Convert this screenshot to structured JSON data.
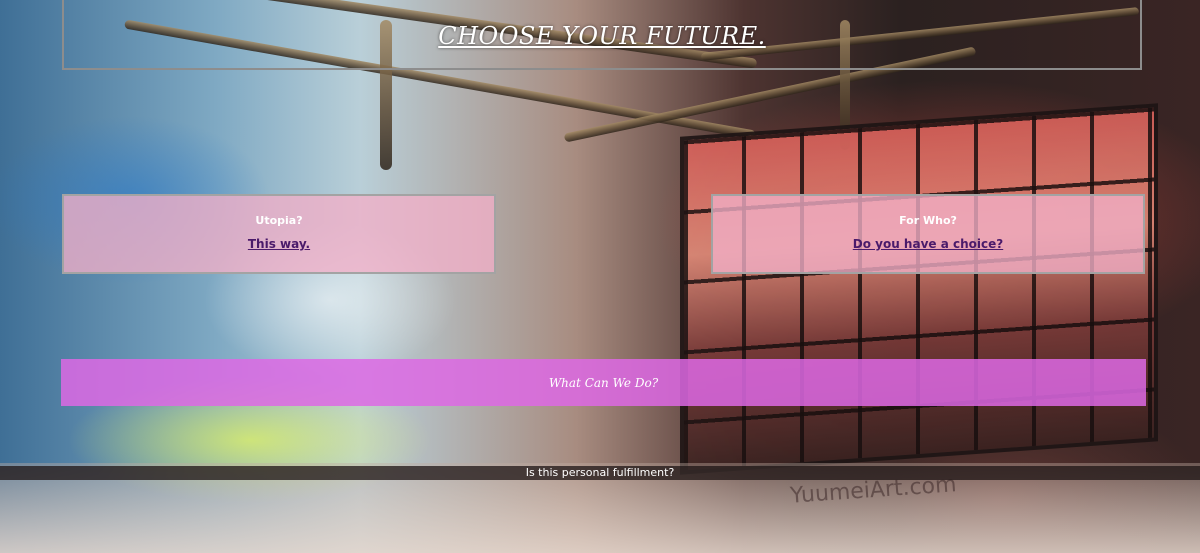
{
  "header": {
    "title": "CHOOSE YOUR FUTURE."
  },
  "cards": [
    {
      "heading": "Utopia?",
      "link_label": "This way."
    },
    {
      "heading": "For Who?",
      "link_label": "Do you have a choice?"
    }
  ],
  "action": {
    "label": "What Can We Do?"
  },
  "footer": {
    "text": "Is this personal fulfillment?"
  },
  "background": {
    "watermark": "YuumeiArt.com"
  },
  "colors": {
    "card_fill": "#f2b0c8",
    "action_fill": "#dd68e4",
    "link_text": "#4a1a6a",
    "frame_border": "#8d8d8d"
  }
}
